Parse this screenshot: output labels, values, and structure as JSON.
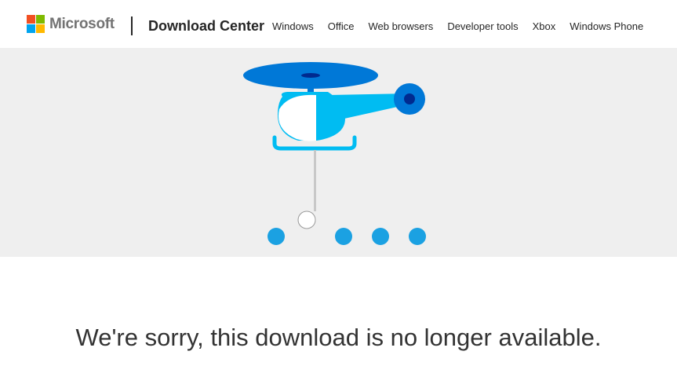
{
  "header": {
    "brand": "Microsoft",
    "site_title": "Download Center",
    "nav": [
      {
        "label": "Windows"
      },
      {
        "label": "Office"
      },
      {
        "label": "Web browsers"
      },
      {
        "label": "Developer tools"
      },
      {
        "label": "Xbox"
      },
      {
        "label": "Windows Phone"
      }
    ]
  },
  "hero": {
    "illustration": "helicopter-icon",
    "background": "#efefef",
    "colors": {
      "rotor": "#0078d7",
      "body": "#00bcf2",
      "dots": "#1ba1e2"
    }
  },
  "message": {
    "text": "We're sorry, this download is no longer available."
  }
}
